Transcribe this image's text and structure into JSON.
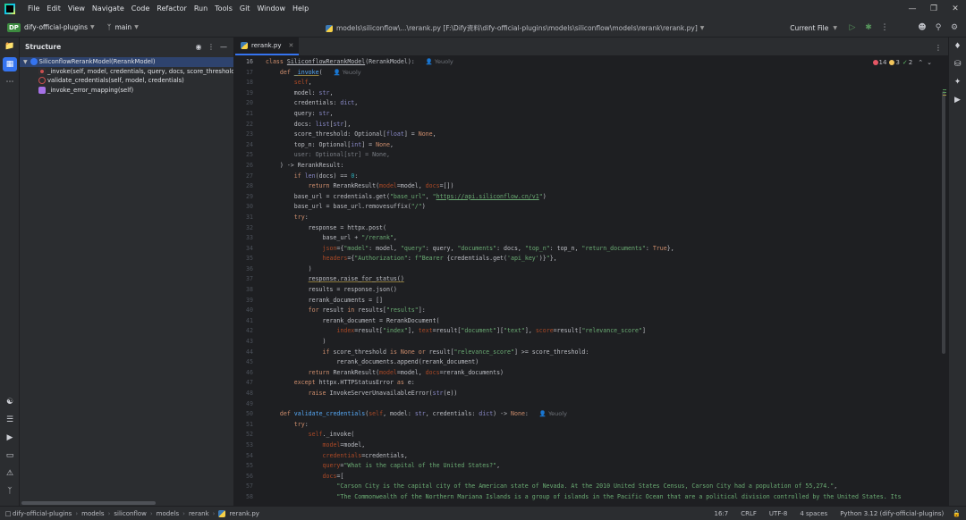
{
  "menu": [
    "File",
    "Edit",
    "View",
    "Navigate",
    "Code",
    "Refactor",
    "Run",
    "Tools",
    "Git",
    "Window",
    "Help"
  ],
  "toolbar": {
    "project_badge": "DP",
    "project_name": "dify-official-plugins",
    "branch": "main",
    "path_title": "models\\siliconflow\\...\\rerank.py [F:\\Dify资料\\dify-official-plugins\\models\\siliconflow\\models\\rerank\\rerank.py]",
    "run_config": "Current File"
  },
  "structure": {
    "title": "Structure",
    "items": [
      {
        "label": "SiliconflowRerankModel(RerankModel)"
      },
      {
        "label": "_invoke(self, model, credentials, query, docs, score_threshold=None"
      },
      {
        "label": "validate_credentials(self, model, credentials)"
      },
      {
        "label": "_invoke_error_mapping(self)"
      }
    ]
  },
  "editor": {
    "tab_label": "rerank.py",
    "inspections": {
      "errors": "14",
      "warnings": "3",
      "weak": "2"
    },
    "author": "Yeuoly"
  },
  "code_lines": [
    {
      "n": "16",
      "html": "<span class='k'>class</span> <span class='u' style='color:#bcbec4'>SiliconflowRerankModel</span>(RerankModel):<span class='blame'>&#128100; Yeuoly</span>"
    },
    {
      "n": "17",
      "html": "    <span class='k'>def</span> <span class='f warn-u'>_invoke</span>(<span class='blame'>&#128100; Yeuoly</span>"
    },
    {
      "n": "18",
      "html": "        <span class='p'>self</span>,"
    },
    {
      "n": "19",
      "html": "        model: <span class='bi'>str</span>,"
    },
    {
      "n": "20",
      "html": "        credentials: <span class='bi'>dict</span>,"
    },
    {
      "n": "21",
      "html": "        query: <span class='bi'>str</span>,"
    },
    {
      "n": "22",
      "html": "        docs: <span class='bi'>list</span>[<span class='bi'>str</span>],"
    },
    {
      "n": "23",
      "html": "        score_threshold: Optional[<span class='bi'>float</span>] = <span class='k'>None</span>,"
    },
    {
      "n": "24",
      "html": "        top_n: Optional[<span class='bi'>int</span>] = <span class='k'>None</span>,"
    },
    {
      "n": "25",
      "html": "        <span class='c'>user: Optional[str] = None,</span>"
    },
    {
      "n": "26",
      "html": "    ) -> RerankResult:"
    },
    {
      "n": "27",
      "html": "        <span class='k'>if</span> <span class='bi'>len</span>(docs) == <span class='n'>0</span>:"
    },
    {
      "n": "28",
      "html": "            <span class='k'>return</span> RerankResult(<span class='p'>model</span>=model, <span class='p'>docs</span>=[])"
    },
    {
      "n": "29",
      "html": "        base_url = credentials.get(<span class='s'>\"base_url\"</span>, <span class='s'>\"<u>https://api.siliconflow.cn/v1</u>\"</span>)"
    },
    {
      "n": "30",
      "html": "        base_url = base_url.removesuffix(<span class='s'>\"/\"</span>)"
    },
    {
      "n": "31",
      "html": "        <span class='k'>try</span>:"
    },
    {
      "n": "32",
      "html": "            response = httpx.post("
    },
    {
      "n": "33",
      "html": "                base_url + <span class='s'>\"/rerank\"</span>,"
    },
    {
      "n": "34",
      "html": "                <span class='p'>json</span>={<span class='s'>\"model\"</span>: model, <span class='s'>\"query\"</span>: query, <span class='s'>\"documents\"</span>: docs, <span class='s'>\"top_n\"</span>: top_n, <span class='s'>\"return_documents\"</span>: <span class='k'>True</span>},"
    },
    {
      "n": "35",
      "html": "                <span class='p'>headers</span>={<span class='s'>\"Authorization\"</span>: <span class='s'>f\"Bearer </span>{credentials.get(<span class='s'>'api_key'</span>)}<span class='s'>\"</span>},"
    },
    {
      "n": "36",
      "html": "            )"
    },
    {
      "n": "37",
      "html": "            <span class='warn-u'>response.raise_for_status()</span>"
    },
    {
      "n": "38",
      "html": "            results = response.json()"
    },
    {
      "n": "39",
      "html": "            rerank_documents = []"
    },
    {
      "n": "40",
      "html": "            <span class='k'>for</span> result <span class='k'>in</span> results[<span class='s'>\"results\"</span>]:"
    },
    {
      "n": "41",
      "html": "                rerank_document = RerankDocument("
    },
    {
      "n": "42",
      "html": "                    <span class='p'>index</span>=result[<span class='s'>\"index\"</span>], <span class='p'>text</span>=result[<span class='s'>\"document\"</span>][<span class='s'>\"text\"</span>], <span class='p'>score</span>=result[<span class='s'>\"relevance_score\"</span>]"
    },
    {
      "n": "43",
      "html": "                )"
    },
    {
      "n": "44",
      "html": "                <span class='k'>if</span> score_threshold <span class='k'>is None or</span> result[<span class='s'>\"relevance_score\"</span>] >= score_threshold:"
    },
    {
      "n": "45",
      "html": "                    rerank_documents.append(rerank_document)"
    },
    {
      "n": "46",
      "html": "            <span class='k'>return</span> RerankResult(<span class='p'>model</span>=model, <span class='p'>docs</span>=rerank_documents)"
    },
    {
      "n": "47",
      "html": "        <span class='k'>except</span> httpx.HTTPStatusError <span class='k'>as</span> e:"
    },
    {
      "n": "48",
      "html": "            <span class='k'>raise</span> InvokeServerUnavailableError(<span class='bi'>str</span>(e))"
    },
    {
      "n": "49",
      "html": ""
    },
    {
      "n": "50",
      "html": "    <span class='k'>def</span> <span class='f'>validate_credentials</span>(<span class='p'>self</span>, model: <span class='bi'>str</span>, credentials: <span class='bi'>dict</span>) -> <span class='k'>None</span>:<span class='blame'>&#128100; Yeuoly</span>"
    },
    {
      "n": "51",
      "html": "        <span class='k'>try</span>:"
    },
    {
      "n": "52",
      "html": "            <span class='p'>self</span>._invoke("
    },
    {
      "n": "53",
      "html": "                <span class='p'>model</span>=model,"
    },
    {
      "n": "54",
      "html": "                <span class='p'>credentials</span>=credentials,"
    },
    {
      "n": "55",
      "html": "                <span class='p'>query</span>=<span class='s'>\"What is the capital of the United States?\"</span>,"
    },
    {
      "n": "56",
      "html": "                <span class='p'>docs</span>=["
    },
    {
      "n": "57",
      "html": "                    <span class='s'>\"Carson City is the capital city of the American state of Nevada. At the 2010 United States Census, Carson City had a population of 55,274.\"</span>,"
    },
    {
      "n": "58",
      "html": "                    <span class='s'>\"The Commonwealth of the Northern Mariana Islands is a group of islands in the Pacific Ocean that are a political division controlled by the United States. Its</span>"
    }
  ],
  "statusbar": {
    "breadcrumbs": [
      "dify-official-plugins",
      "models",
      "siliconflow",
      "models",
      "rerank",
      "rerank.py"
    ],
    "position": "16:7",
    "line_sep": "CRLF",
    "encoding": "UTF-8",
    "indent": "4 spaces",
    "interpreter": "Python 3.12 (dify-official-plugins)"
  },
  "colors": {
    "accent": "#3574f0",
    "selection": "#2e436e",
    "bg": "#1e1f22",
    "panel": "#2b2d30"
  }
}
